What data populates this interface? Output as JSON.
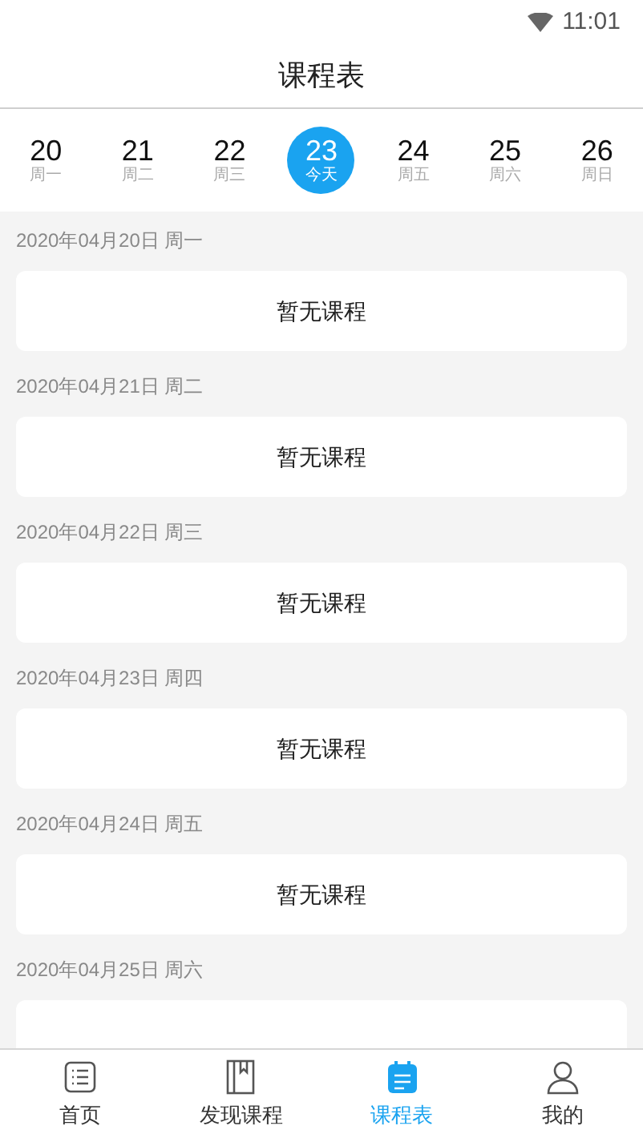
{
  "status_bar": {
    "time": "11:01"
  },
  "header": {
    "title": "课程表"
  },
  "week": [
    {
      "date": "20",
      "day": "周一",
      "selected": false
    },
    {
      "date": "21",
      "day": "周二",
      "selected": false
    },
    {
      "date": "22",
      "day": "周三",
      "selected": false
    },
    {
      "date": "23",
      "day": "今天",
      "selected": true
    },
    {
      "date": "24",
      "day": "周五",
      "selected": false
    },
    {
      "date": "25",
      "day": "周六",
      "selected": false
    },
    {
      "date": "26",
      "day": "周日",
      "selected": false
    }
  ],
  "schedule": [
    {
      "heading": "2020年04月20日 周一",
      "empty_text": "暂无课程"
    },
    {
      "heading": "2020年04月21日 周二",
      "empty_text": "暂无课程"
    },
    {
      "heading": "2020年04月22日 周三",
      "empty_text": "暂无课程"
    },
    {
      "heading": "2020年04月23日 周四",
      "empty_text": "暂无课程"
    },
    {
      "heading": "2020年04月24日 周五",
      "empty_text": "暂无课程"
    },
    {
      "heading": "2020年04月25日 周六"
    }
  ],
  "tab_bar": [
    {
      "kind": "home",
      "label": "首页",
      "selected": false
    },
    {
      "kind": "discover",
      "label": "发现课程",
      "selected": false
    },
    {
      "kind": "schedule",
      "label": "课程表",
      "selected": true
    },
    {
      "kind": "profile",
      "label": "我的",
      "selected": false
    }
  ]
}
